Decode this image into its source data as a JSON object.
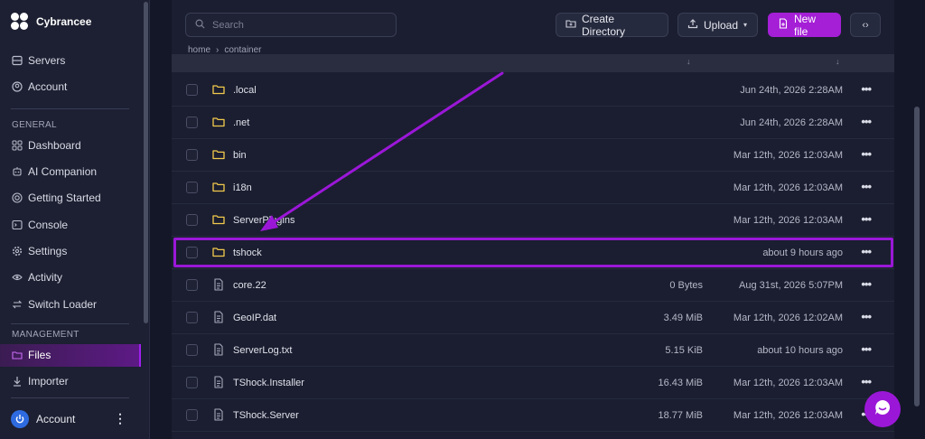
{
  "brand": {
    "name": "Cybrancee"
  },
  "sidebar": {
    "top_items": [
      {
        "label": "Servers",
        "icon": "server-icon"
      },
      {
        "label": "Account",
        "icon": "user-circle-icon"
      }
    ],
    "general_label": "GENERAL",
    "general_items": [
      {
        "label": "Dashboard",
        "icon": "grid-icon"
      },
      {
        "label": "AI Companion",
        "icon": "robot-icon"
      },
      {
        "label": "Getting Started",
        "icon": "lifebuoy-icon"
      },
      {
        "label": "Console",
        "icon": "terminal-icon"
      },
      {
        "label": "Settings",
        "icon": "gear-icon"
      },
      {
        "label": "Activity",
        "icon": "eye-icon"
      },
      {
        "label": "Switch Loader",
        "icon": "swap-icon"
      }
    ],
    "management_label": "MANAGEMENT",
    "management_items": [
      {
        "label": "Files",
        "icon": "folder-icon",
        "active": true
      },
      {
        "label": "Importer",
        "icon": "download-icon"
      }
    ],
    "account_label": "Account"
  },
  "toolbar": {
    "search_placeholder": "Search",
    "create_directory": "Create Directory",
    "upload": "Upload",
    "new_file": "New file"
  },
  "breadcrumb": {
    "root": "home",
    "current": "container"
  },
  "files": [
    {
      "name": ".local",
      "type": "folder",
      "size": "",
      "modified": "Jun 24th, 2026 2:28AM"
    },
    {
      "name": ".net",
      "type": "folder",
      "size": "",
      "modified": "Jun 24th, 2026 2:28AM"
    },
    {
      "name": "bin",
      "type": "folder",
      "size": "",
      "modified": "Mar 12th, 2026 12:03AM"
    },
    {
      "name": "i18n",
      "type": "folder",
      "size": "",
      "modified": "Mar 12th, 2026 12:03AM"
    },
    {
      "name": "ServerPlugins",
      "type": "folder",
      "size": "",
      "modified": "Mar 12th, 2026 12:03AM"
    },
    {
      "name": "tshock",
      "type": "folder",
      "size": "",
      "modified": "about 9 hours ago",
      "highlighted": true
    },
    {
      "name": "core.22",
      "type": "file",
      "size": "0 Bytes",
      "modified": "Aug 31st, 2026 5:07PM"
    },
    {
      "name": "GeoIP.dat",
      "type": "file",
      "size": "3.49 MiB",
      "modified": "Mar 12th, 2026 12:02AM"
    },
    {
      "name": "ServerLog.txt",
      "type": "file",
      "size": "5.15 KiB",
      "modified": "about 10 hours ago"
    },
    {
      "name": "TShock.Installer",
      "type": "file",
      "size": "16.43 MiB",
      "modified": "Mar 12th, 2026 12:03AM"
    },
    {
      "name": "TShock.Server",
      "type": "file",
      "size": "18.77 MiB",
      "modified": "Mar 12th, 2026 12:03AM"
    }
  ],
  "colors": {
    "accent": "#a41fd6",
    "folder": "#f2c94c",
    "annotation": "#9b17d8"
  }
}
